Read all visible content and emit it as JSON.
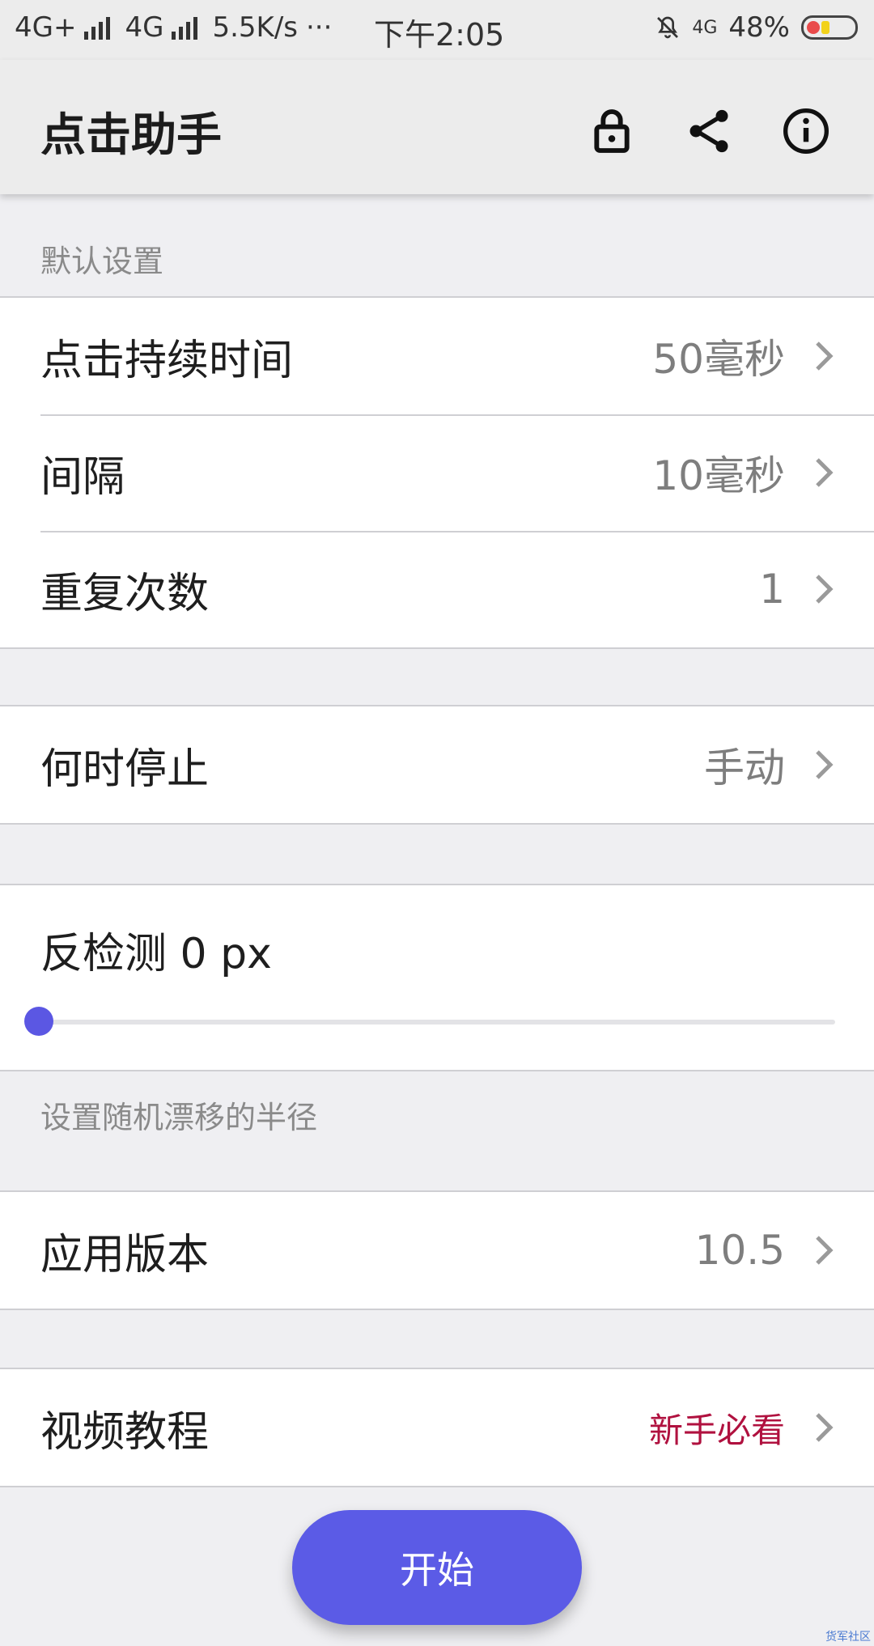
{
  "status_bar": {
    "network1": "4G+",
    "network2": "4G",
    "speed": "5.5K/s",
    "dots": "···",
    "time": "下午2:05",
    "net_small": "4G",
    "battery": "48%"
  },
  "app_bar": {
    "title": "点击助手",
    "icons": [
      "lock-icon",
      "share-icon",
      "info-icon"
    ]
  },
  "default_settings": {
    "header": "默认设置",
    "rows": [
      {
        "label": "点击持续时间",
        "value": "50毫秒"
      },
      {
        "label": "间隔",
        "value": "10毫秒"
      },
      {
        "label": "重复次数",
        "value": "1"
      }
    ]
  },
  "stop": {
    "label": "何时停止",
    "value": "手动"
  },
  "anti_detect": {
    "label": "反检测 0 px",
    "slider_value": 0,
    "helper": "设置随机漂移的半径"
  },
  "version": {
    "label": "应用版本",
    "value": "10.5"
  },
  "video": {
    "label": "视频教程",
    "value": "新手必看"
  },
  "start_button": "开始",
  "watermark": "货军社区",
  "colors": {
    "accent": "#5b5be6",
    "red_text": "#b0113f",
    "background": "#efeff2"
  }
}
